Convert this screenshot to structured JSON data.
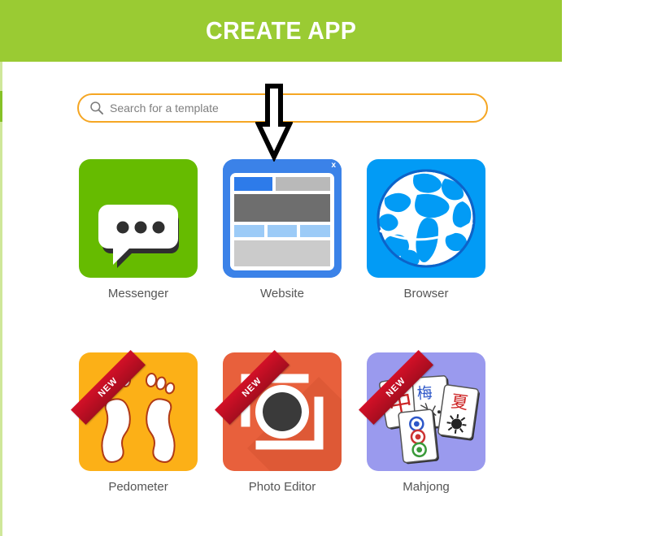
{
  "header": {
    "title": "CREATE APP",
    "background_color": "#9acb33",
    "text_color": "#ffffff"
  },
  "search": {
    "placeholder": "Search for a template",
    "value": "",
    "icon": "search-icon",
    "border_color": "#f5a623"
  },
  "annotation": {
    "type": "down-arrow",
    "color": "#000000",
    "points_to": "Website"
  },
  "templates": {
    "rows": [
      {
        "items": [
          {
            "label": "Messenger",
            "icon": "chat-bubble-icon",
            "tile_color": "#66bb00",
            "badge": "",
            "selected": false
          },
          {
            "label": "Website",
            "icon": "browser-window-icon",
            "tile_color": "#3b82e8",
            "badge": "",
            "selected": true,
            "close_label": "x"
          },
          {
            "label": "Browser",
            "icon": "globe-icon",
            "tile_color": "#029bf5",
            "badge": "",
            "selected": false
          }
        ]
      },
      {
        "items": [
          {
            "label": "Pedometer",
            "icon": "footprints-icon",
            "tile_color": "#fcb017",
            "badge": "NEW",
            "selected": false
          },
          {
            "label": "Photo Editor",
            "icon": "camera-icon",
            "tile_color": "#e8603c",
            "badge": "NEW",
            "selected": false
          },
          {
            "label": "Mahjong",
            "icon": "mahjong-tiles-icon",
            "tile_color": "#9a9aee",
            "badge": "NEW",
            "selected": false
          }
        ]
      }
    ]
  },
  "mahjong_glyphs": {
    "tile1": "中",
    "tile2": "梅",
    "tile3": "夏"
  }
}
